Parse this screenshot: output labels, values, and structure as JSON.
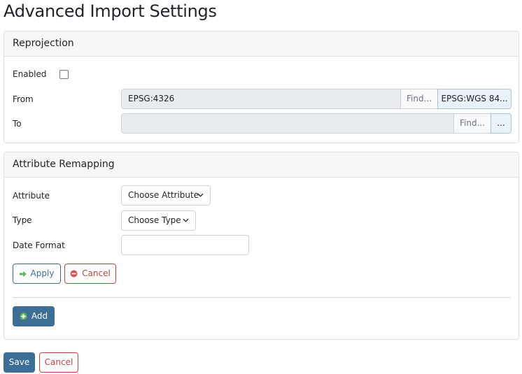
{
  "page": {
    "title": "Advanced Import Settings"
  },
  "reprojection": {
    "header": "Reprojection",
    "enabled_label": "Enabled",
    "enabled_checked": false,
    "from_label": "From",
    "from_value": "EPSG:4326",
    "from_find": "Find...",
    "from_button": "EPSG:WGS 84...",
    "to_label": "To",
    "to_value": "",
    "to_find": "Find...",
    "to_button": "..."
  },
  "attribute_remapping": {
    "header": "Attribute Remapping",
    "attribute_label": "Attribute",
    "attribute_select": "Choose Attribute",
    "type_label": "Type",
    "type_select": "Choose Type",
    "date_format_label": "Date Format",
    "date_format_value": "",
    "apply_label": "Apply",
    "cancel_label": "Cancel",
    "add_label": "Add"
  },
  "footer": {
    "save_label": "Save",
    "cancel_label": "Cancel"
  },
  "colors": {
    "primary": "#3d6e96",
    "danger": "#c0463c",
    "success": "#5cb85c"
  }
}
